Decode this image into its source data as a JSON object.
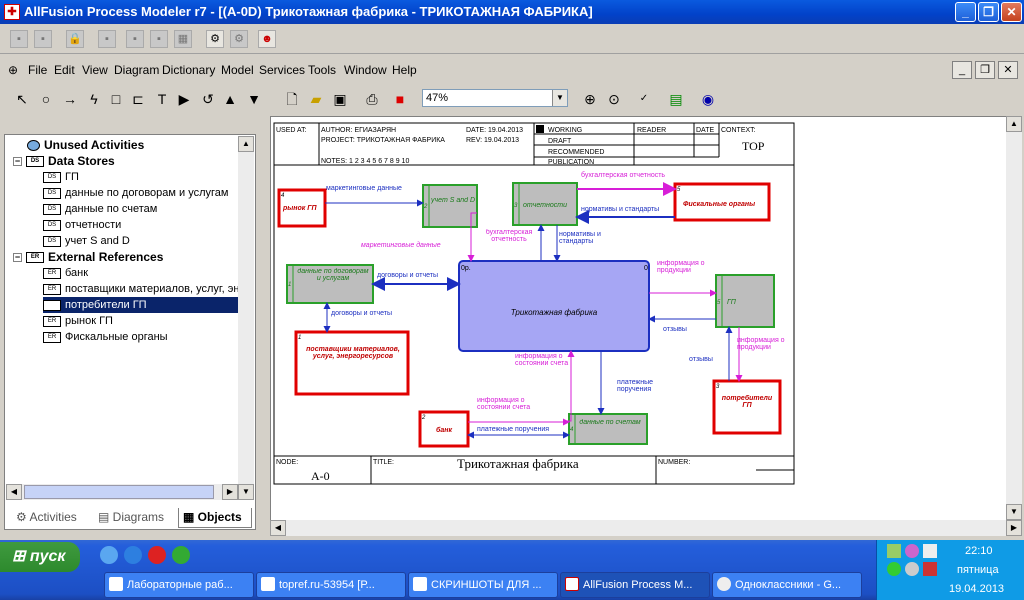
{
  "window": {
    "title": "AllFusion Process Modeler r7 - [(A-0D) Трикотажная фабрика - ТРИКОТАЖНАЯ ФАБРИКА]"
  },
  "menu": [
    "File",
    "Edit",
    "View",
    "Diagram",
    "Dictionary",
    "Model",
    "Services",
    "Tools",
    "Window",
    "Help"
  ],
  "toolbar": {
    "zoom": "47%"
  },
  "tree": {
    "unused": "Unused Activities",
    "data_stores_title": "Data Stores",
    "data_stores": [
      "ГП",
      "данные по договорам и услугам",
      "данные по счетам",
      "отчетности",
      "учет S and D"
    ],
    "external_title": "External References",
    "externals": [
      "банк",
      "поставщики материалов, услуг, эн",
      "потребители ГП",
      "рынок ГП",
      "Фискальные органы"
    ]
  },
  "tabs": [
    "Activities",
    "Diagrams",
    "Objects"
  ],
  "diagram": {
    "header": {
      "used_at": "USED AT:",
      "author": "AUTHOR:  ЕГИАЗАРЯН",
      "project": "PROJECT:  ТРИКОТАЖНАЯ ФАБРИКА",
      "date": "DATE:  19.04.2013",
      "rev": "REV:     19.04.2013",
      "notes": "NOTES:  1  2  3  4  5  6  7  8  9  10",
      "working": "WORKING",
      "draft": "DRAFT",
      "recommended": "RECOMMENDED",
      "publication": "PUBLICATION",
      "reader": "READER",
      "date2": "DATE",
      "context": "CONTEXT:",
      "top": "TOP"
    },
    "footer": {
      "node_label": "NODE:",
      "node": "A-0",
      "title_label": "TITLE:",
      "title": "Трикотажная фабрика",
      "number_label": "NUMBER:"
    },
    "activity": {
      "label": "Трикотажная фабрика",
      "cost": "0р.",
      "num": "0"
    },
    "externals": {
      "market": "рынок ГП",
      "fiscal": "Фискальные органы",
      "suppliers": "поставщики материалов, услуг, энергоресурсов",
      "consumers": "потребители ГП",
      "bank": "банк"
    },
    "stores": {
      "sd": "учет S and D",
      "reports": "отчетности",
      "contracts": "данные по договорам и услугам",
      "gp": "ГП",
      "accounts": "данные по счетам"
    },
    "store_nums": {
      "sd": "2",
      "reports": "3",
      "contracts": "1",
      "gp": "5",
      "accounts": "4"
    },
    "ext_nums": {
      "market": "4",
      "fiscal": "5",
      "suppliers": "1",
      "consumers": "3",
      "bank": "2"
    },
    "arrows": {
      "a1": "маркетинговые данные",
      "a2": "маркетинговые данные",
      "a3": "бухгалтерская отчетность",
      "a3b": "бухгалтерская отчетность",
      "a4": "нормативы и стандарты",
      "a4b": "нормативы и стандарты",
      "a5": "договоры и отчеты",
      "a6": "договоры и отчеты",
      "a7": "информация о продукции",
      "a8": "отзывы",
      "a9": "отзывы",
      "a10": "информация о продукции",
      "a11": "информация о состоянии счета",
      "a12": "платежные поручения",
      "a13": "информация о состоянии счета",
      "a14": "платежные поручения"
    }
  },
  "taskbar": {
    "start": "пуск",
    "buttons": [
      "Лабораторные раб...",
      "topref.ru-53954 [Р...",
      "СКРИНШОТЫ ДЛЯ ...",
      "AllFusion Process M...",
      "Одноклассники - G..."
    ],
    "time": "22:10",
    "day": "пятница",
    "date": "19.04.2013"
  }
}
